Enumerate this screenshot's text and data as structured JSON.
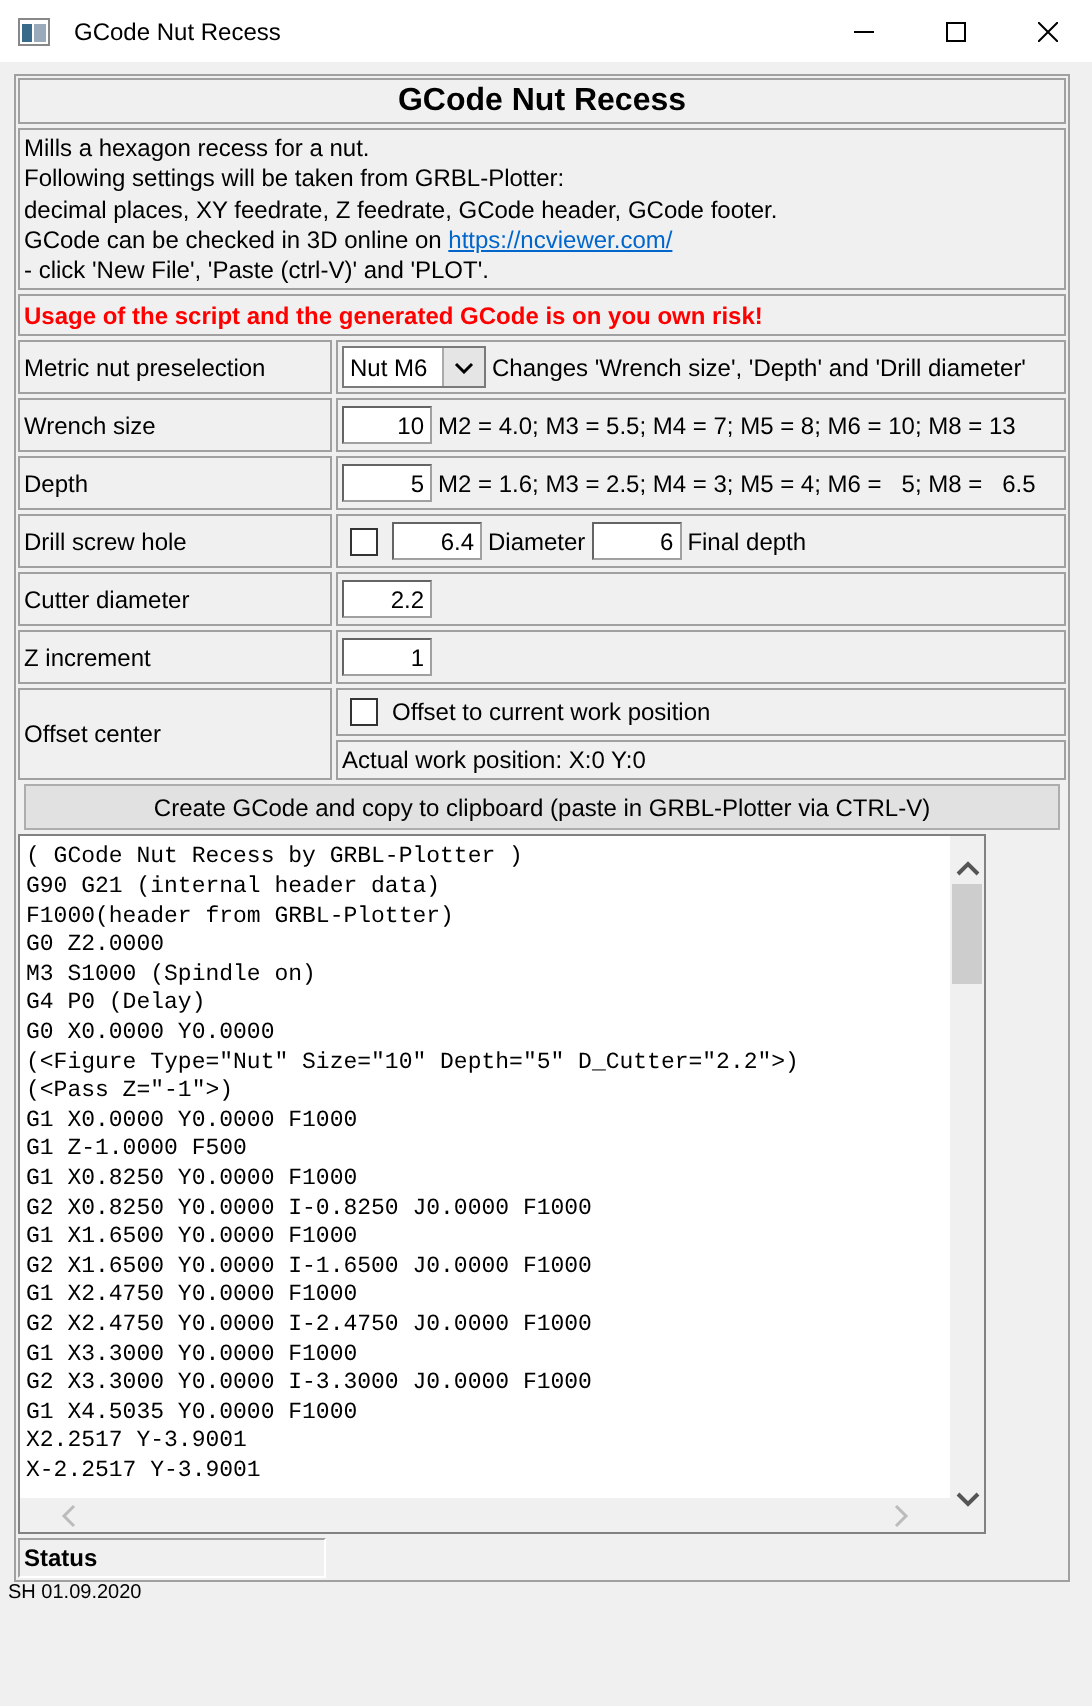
{
  "window": {
    "title": "GCode Nut Recess"
  },
  "heading": "GCode Nut Recess",
  "description": {
    "lines": [
      "Mills a hexagon recess for a nut.",
      "Following settings will be taken from GRBL-Plotter:",
      "decimal places, XY feedrate, Z feedrate, GCode header, GCode footer."
    ],
    "check_text": "GCode can be checked in 3D online on",
    "link": "https://ncviewer.com/",
    "last_line": "- click 'New File', 'Paste (ctrl-V)' and 'PLOT'."
  },
  "warning": "Usage of the script and the generated GCode is on you own risk!",
  "rows": [
    {
      "kind": "select",
      "label": "Metric nut preselection",
      "value": "Nut M6",
      "note": "Changes 'Wrench size', 'Depth' and 'Drill diameter'"
    },
    {
      "kind": "number",
      "label": "Wrench size",
      "value": "10",
      "note": "M2 = 4.0; M3 = 5.5; M4 = 7; M5 = 8; M6 = 10; M8 = 13"
    },
    {
      "kind": "number",
      "label": "Depth",
      "value": "5",
      "note": "M2 = 1.6; M3 = 2.5; M4 = 3; M5 = 4; M6 =   5; M8 =   6.5"
    },
    {
      "kind": "drill",
      "label": "Drill screw hole",
      "checked": false,
      "diameter": "6.4",
      "diameter_label": "Diameter",
      "depth": "6",
      "depth_label": "Final depth"
    },
    {
      "kind": "number",
      "label": "Cutter diameter",
      "value": "2.2"
    },
    {
      "kind": "number",
      "label": "Z increment",
      "value": "1"
    },
    {
      "kind": "offset",
      "label": "Offset center",
      "checked": false,
      "option": "Offset to current work position",
      "info": "Actual work position: X:0 Y:0"
    }
  ],
  "create_button": "Create GCode and copy to clipboard (paste in GRBL-Plotter via CTRL-V)",
  "code_lines": [
    "( GCode Nut Recess by GRBL-Plotter )",
    "G90 G21 (internal header data)",
    "F1000(header from GRBL-Plotter)",
    "G0 Z2.0000",
    "M3 S1000 (Spindle on)",
    "G4 P0 (Delay)",
    "G0 X0.0000 Y0.0000",
    "(<Figure Type=\"Nut\" Size=\"10\" Depth=\"5\" D_Cutter=\"2.2\">)",
    "(<Pass Z=\"-1\">)",
    "G1 X0.0000 Y0.0000 F1000",
    "G1 Z-1.0000 F500",
    "G1 X0.8250 Y0.0000 F1000",
    "G2 X0.8250 Y0.0000 I-0.8250 J0.0000 F1000",
    "G1 X1.6500 Y0.0000 F1000",
    "G2 X1.6500 Y0.0000 I-1.6500 J0.0000 F1000",
    "G1 X2.4750 Y0.0000 F1000",
    "G2 X2.4750 Y0.0000 I-2.4750 J0.0000 F1000",
    "G1 X3.3000 Y0.0000 F1000",
    "G2 X3.3000 Y0.0000 I-3.3000 J0.0000 F1000",
    "G1 X4.5035 Y0.0000 F1000",
    "X2.2517 Y-3.9001",
    "X-2.2517 Y-3.9001"
  ],
  "status": "Status",
  "footer": "SH 01.09.2020"
}
